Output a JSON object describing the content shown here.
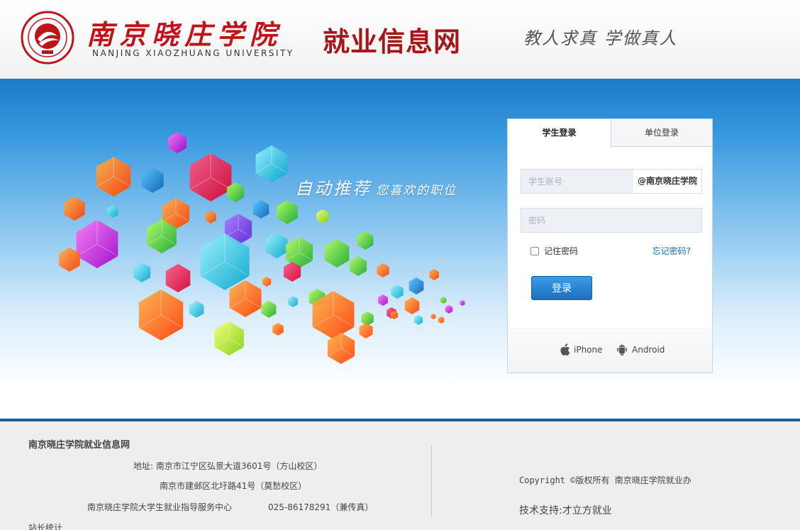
{
  "header": {
    "university_cn": "南京晓庄学院",
    "university_en": "NANJING XIAOZHUANG UNIVERSITY",
    "site_title": "就业信息网",
    "motto": "教人求真 学做真人"
  },
  "banner": {
    "slogan_main": "自动推荐",
    "slogan_sub": "您喜欢的职位"
  },
  "login": {
    "tab_student": "学生登录",
    "tab_unit": "单位登录",
    "account_placeholder": "学生账号",
    "account_suffix": "@南京晓庄学院",
    "password_placeholder": "密码",
    "remember_label": "记住密码",
    "forgot_label": "忘记密码?",
    "submit_label": "登录",
    "app_iphone": "iPhone",
    "app_android": "Android"
  },
  "footer": {
    "title": "南京晓庄学院就业信息网",
    "address_1": "地址: 南京市江宁区弘景大道3601号（方山校区）",
    "address_2": "南京市建邺区北圩路41号（莫愁校区）",
    "center_name": "南京晓庄学院大学生就业指导服务中心",
    "phone": "025-86178291（兼传真）",
    "stats": "站长统计",
    "copyright": "Copyright ©版权所有 南京晓庄学院就业办",
    "tech_support": "技术支持:才立方就业"
  },
  "colors": {
    "brand_red": "#c1121c",
    "primary_blue": "#1c5f9d",
    "button_blue": "#2a86d6"
  }
}
